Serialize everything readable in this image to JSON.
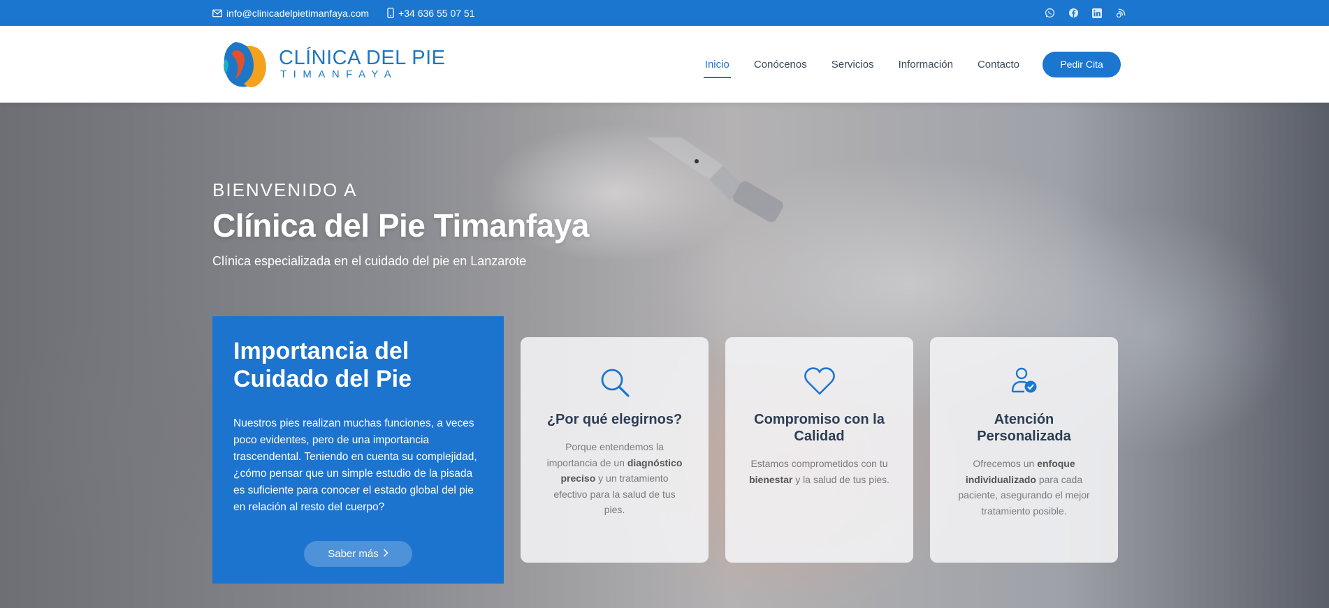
{
  "topbar": {
    "email": "info@clinicadelpietimanfaya.com",
    "phone": "+34 636 55 07 51",
    "social_icons": [
      "whatsapp-icon",
      "facebook-icon",
      "linkedin-icon",
      "blog-icon"
    ]
  },
  "logo": {
    "line1": "CLÍNICA DEL PIE",
    "line2": "TIMANFAYA"
  },
  "nav": {
    "items": [
      "Inicio",
      "Conócenos",
      "Servicios",
      "Información",
      "Contacto"
    ],
    "active": "Inicio",
    "cta": "Pedir Cita"
  },
  "hero": {
    "pre_title": "BIENVENIDO A",
    "title": "Clínica del Pie Timanfaya",
    "subtitle": "Clínica especializada en el cuidado del pie en Lanzarote"
  },
  "importance": {
    "title": "Importancia del Cuidado del Pie",
    "body": "Nuestros pies realizan muchas funciones, a veces poco evidentes, pero de una importancia trascendental. Teniendo en cuenta su complejidad, ¿cómo pensar que un simple estudio de la pisada es suficiente para conocer el estado global del pie en relación al resto del cuerpo?",
    "button": "Saber más",
    "button_icon": "chevron-right-icon"
  },
  "features": [
    {
      "icon": "search-icon",
      "title": "¿Por qué elegirnos?",
      "text_before": "Porque entendemos la importancia de un ",
      "bold": "diagnóstico preciso",
      "text_after": " y un tratamiento efectivo para la salud de tus pies."
    },
    {
      "icon": "heart-icon",
      "title": "Compromiso con la Calidad",
      "text_before": "Estamos comprometidos con tu ",
      "bold": "bienestar",
      "text_after": " y la salud de tus pies."
    },
    {
      "icon": "user-check-icon",
      "title": "Atención Personalizada",
      "text_before": "Ofrecemos un ",
      "bold": "enfoque individualizado",
      "text_after": " para cada paciente, asegurando el mejor tratamiento posible."
    }
  ],
  "colors": {
    "primary": "#1b76cf",
    "heading_dark": "#2c3e55",
    "body_gray": "#7a7a7a"
  }
}
